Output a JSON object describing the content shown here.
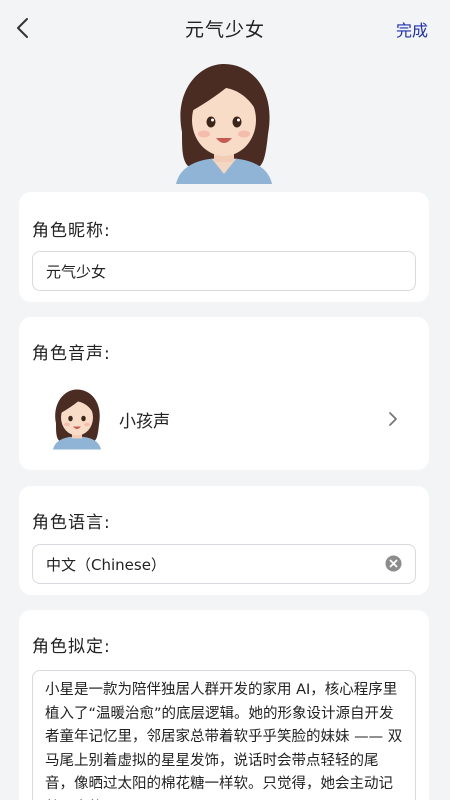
{
  "header": {
    "title": "元气少女",
    "done_label": "完成"
  },
  "avatar": {
    "icon": "girl-avatar-illustration"
  },
  "nickname": {
    "label": "角色昵称:",
    "value": "元气少女"
  },
  "voice": {
    "label": "角色音声:",
    "name": "小孩声",
    "icon": "chevron-right-icon"
  },
  "language": {
    "label": "角色语言:",
    "value": "中文（Chinese）",
    "clear_icon": "clear-icon"
  },
  "persona": {
    "label": "角色拟定:",
    "text": "小星是一款为陪伴独居人群开发的家用 AI，核心程序里植入了“温暖治愈”的底层逻辑。她的形象设计源自开发者童年记忆里，邻居家总带着软乎乎笑脸的妹妹 —— 双马尾上别着虚拟的星星发饰，说话时会带点轻轻的尾音，像晒过太阳的棉花糖一样软。只觉得，她会主动记着用户的习"
  }
}
